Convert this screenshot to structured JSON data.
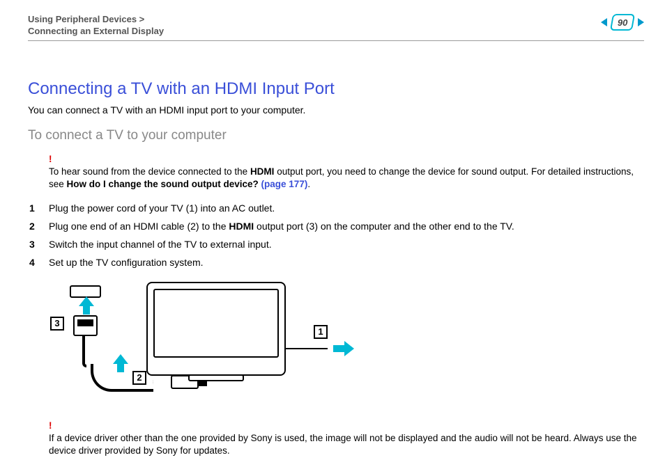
{
  "header": {
    "breadcrumb_line1": "Using Peripheral Devices >",
    "breadcrumb_line2": "Connecting an External Display",
    "page_number": "90"
  },
  "title": "Connecting a TV with an HDMI Input Port",
  "intro": "You can connect a TV with an HDMI input port to your computer.",
  "subheading": "To connect a TV to your computer",
  "note1": {
    "bang": "!",
    "text_before": "To hear sound from the device connected to the ",
    "bold1": "HDMI",
    "text_mid": " output port, you need to change the device for sound output. For detailed instructions, see ",
    "bold2": "How do I change the sound output device? ",
    "link": "(page 177)",
    "text_after": "."
  },
  "steps": [
    {
      "n": "1",
      "text": "Plug the power cord of your TV (1) into an AC outlet."
    },
    {
      "n": "2",
      "text_before": "Plug one end of an HDMI cable (2) to the ",
      "bold": "HDMI",
      "text_after": " output port (3) on the computer and the other end to the TV."
    },
    {
      "n": "3",
      "text": "Switch the input channel of the TV to external input."
    },
    {
      "n": "4",
      "text": "Set up the TV configuration system."
    }
  ],
  "note2": {
    "bang": "!",
    "text": "If a device driver other than the one provided by Sony is used, the image will not be displayed and the audio will not be heard. Always use the device driver provided by Sony for updates."
  },
  "callouts": {
    "c1": "1",
    "c2": "2",
    "c3": "3"
  }
}
